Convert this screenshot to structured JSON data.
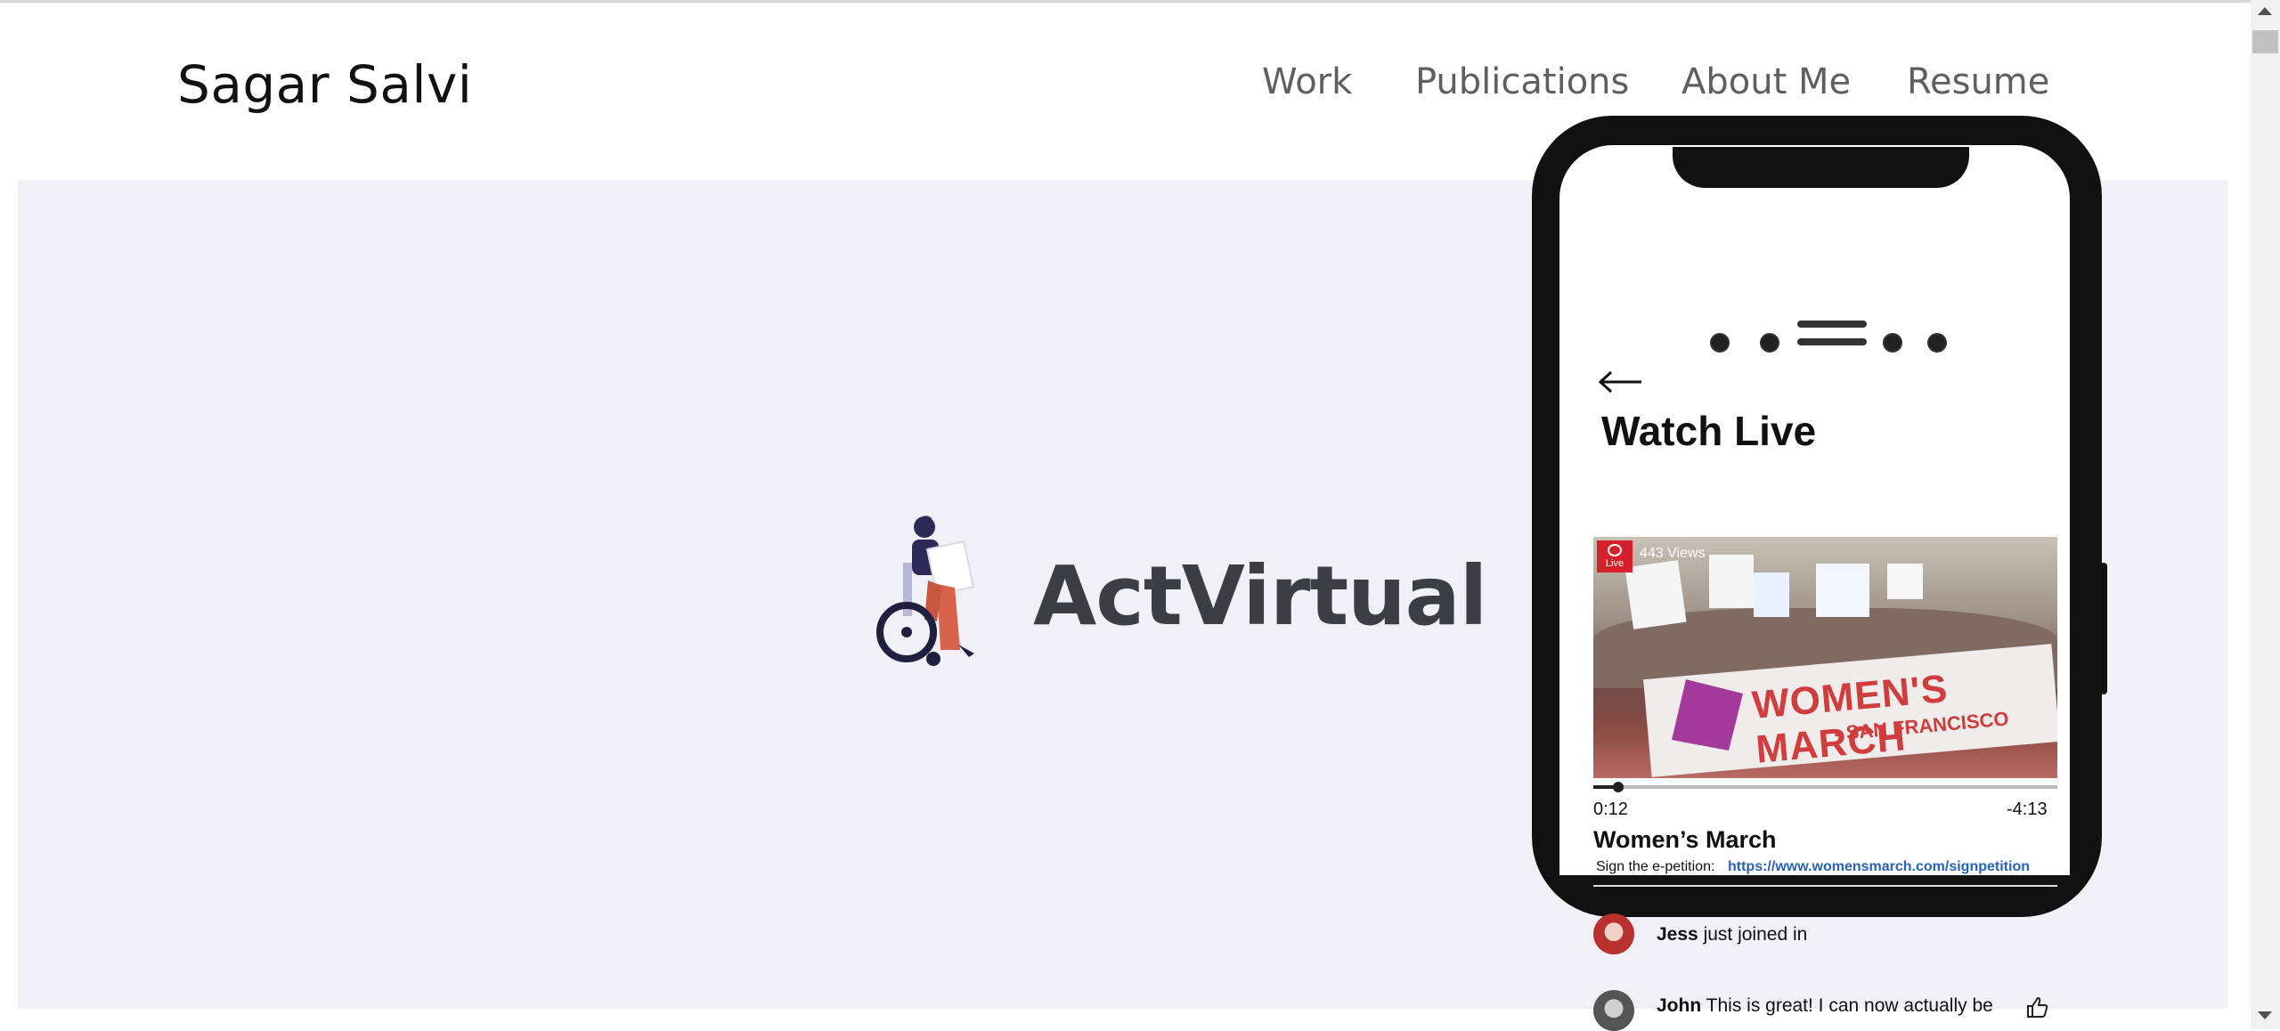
{
  "header": {
    "brand": "Sagar Salvi",
    "nav": [
      {
        "label": "Work"
      },
      {
        "label": "Publications"
      },
      {
        "label": "About Me"
      },
      {
        "label": "Resume"
      }
    ]
  },
  "hero": {
    "logo_text": "ActVirtual",
    "logo_icon": "person-in-wheelchair-icon",
    "phone": {
      "screen_title": "Watch Live",
      "back_icon": "back-arrow-icon",
      "video": {
        "live_label": "Live",
        "views": "443 Views",
        "banner_text": "WOMEN'S MARCH",
        "banner_subtext": "- SAN FRANCISCO",
        "progress": 0.05,
        "elapsed": "0:12",
        "remaining": "-4:13"
      },
      "event_title": "Women’s March",
      "petition_label": "Sign the e-petition:",
      "petition_link": "https://www.womensmarch.com/signpetition",
      "comments": [
        {
          "user": "Jess",
          "text": "just joined in"
        },
        {
          "user": "John",
          "text": "This is great! I can now actually be"
        }
      ]
    }
  },
  "colors": {
    "hero_bg": "#f0f0f6",
    "logo_text": "#3d3d44",
    "nav_text": "#5f5f5f",
    "link": "#2a62b8",
    "live_red": "#d8202c"
  }
}
